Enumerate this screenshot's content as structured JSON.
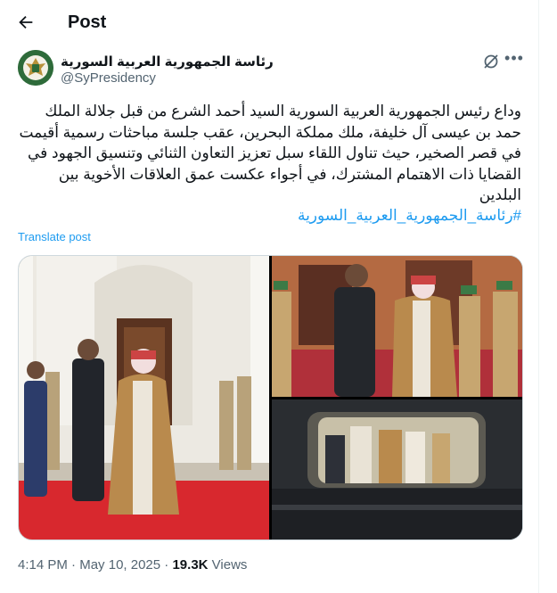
{
  "header": {
    "title": "Post"
  },
  "author": {
    "name": "رئاسة الجمهورية العربية السورية",
    "handle": "@SyPresidency"
  },
  "post": {
    "text": "وداع رئيس الجمهورية العربية السورية السيد أحمد الشرع من قبل جلالة الملك حمد بن عيسى آل خليفة، ملك مملكة البحرين، عقب جلسة مباحثات رسمية أقيمت في قصر الصخير، حيث تناول اللقاء سبل تعزيز التعاون الثنائي وتنسيق الجهود في القضايا ذات الاهتمام المشترك، في أجواء عكست عمق العلاقات الأخوية بين البلدين",
    "hashtag": "#رئاسة_الجمهورية_العربية_السورية",
    "translate_label": "Translate post"
  },
  "footer": {
    "time": "4:14 PM",
    "separator": "·",
    "date": "May 10, 2025",
    "views_count": "19.3K",
    "views_label": "Views"
  },
  "icons": {
    "back": "arrow-left-icon",
    "grok": "grok-icon",
    "more": "more-icon"
  }
}
